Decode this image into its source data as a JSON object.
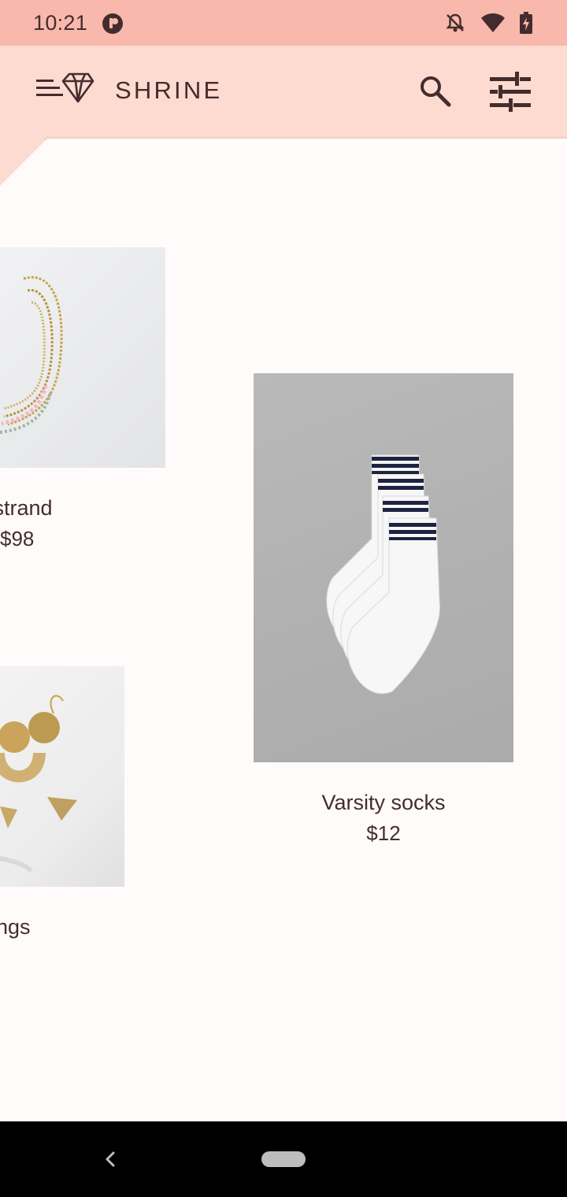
{
  "status_bar": {
    "time": "10:21",
    "icons": [
      "app-notification-icon",
      "dnd-off-icon",
      "wifi-icon",
      "battery-charging-icon"
    ]
  },
  "app_bar": {
    "title": "SHRINE",
    "menu_icon": "menu-icon",
    "brand_icon": "diamond-icon",
    "search_icon": "search-icon",
    "filter_icon": "tune-icon"
  },
  "products": [
    {
      "name": "en strand",
      "price": "$98",
      "image": "necklace-photo"
    },
    {
      "name": "rings",
      "price": "",
      "image": "earrings-photo"
    },
    {
      "name": "Varsity socks",
      "price": "$12",
      "image": "socks-photo"
    }
  ],
  "nav_bar": {
    "back_icon": "back-icon",
    "home_pill": "home-handle"
  },
  "colors": {
    "status_bar_bg": "#F9B8AC",
    "backdrop": "#FEDBD0",
    "surface": "#FFFBFA",
    "on_surface": "#442C2E"
  }
}
